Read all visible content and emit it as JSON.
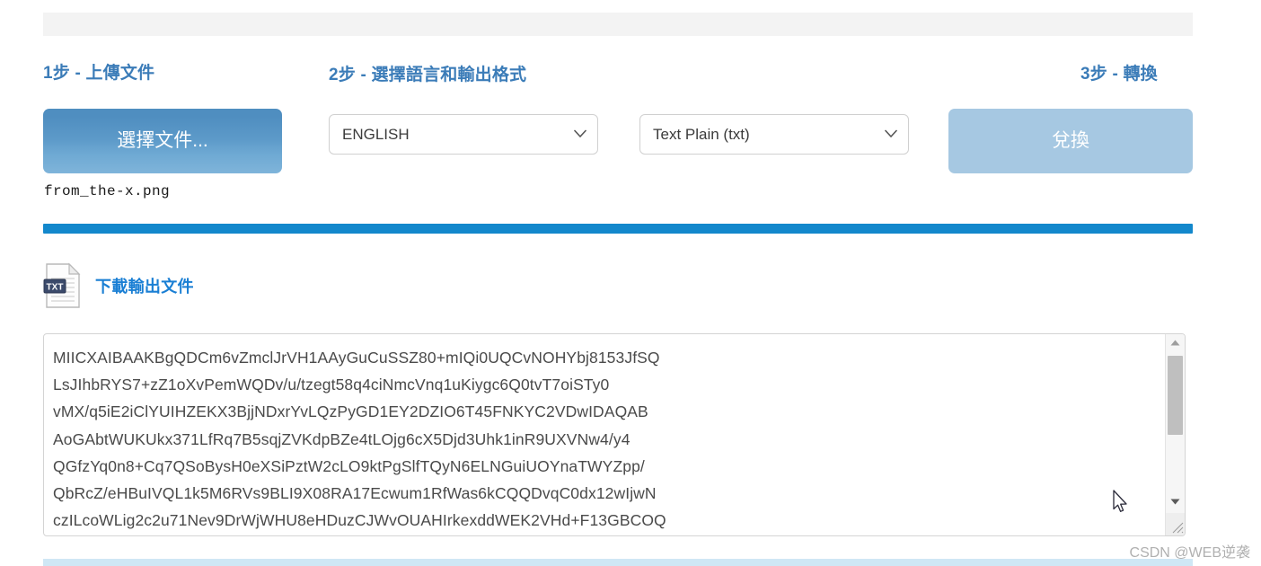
{
  "steps": {
    "step1_heading": "1步 - 上傳文件",
    "step2_heading": "2步 - 選擇語言和輸出格式",
    "step3_heading": "3步 - 轉換"
  },
  "upload": {
    "choose_file_label": "選擇文件...",
    "file_name": "from_the-x.png"
  },
  "options": {
    "language_value": "ENGLISH",
    "format_value": "Text Plain (txt)"
  },
  "convert": {
    "label": "兌換"
  },
  "progress": {
    "percent": 100
  },
  "download": {
    "link_label": "下載輸出文件",
    "icon_badge": "TXT"
  },
  "output": {
    "text": "MIICXAIBAAKBgQDCm6vZmclJrVH1AAyGuCuSSZ80+mIQi0UQCvNOHYbj8153JfSQ\nLsJIhbRYS7+zZ1oXvPemWQDv/u/tzegt58q4ciNmcVnq1uKiygc6Q0tvT7oiSTy0\nvMX/q5iE2iClYUIHZEKX3BjjNDxrYvLQzPyGD1EY2DZIO6T45FNKYC2VDwIDAQAB\nAoGAbtWUKUkx371LfRq7B5sqjZVKdpBZe4tLOjg6cX5Djd3Uhk1inR9UXVNw4/y4\nQGfzYq0n8+Cq7QSoBysH0eXSiPztW2cLO9ktPgSlfTQyN6ELNGuiUOYnaTWYZpp/\nQbRcZ/eHBuIVQL1k5M6RVs9BLI9X08RA17Ecwum1RfWas6kCQQDvqC0dx12wIjwN\nczILcoWLig2c2u71Nev9DrWjWHU8eHDuzCJWvOUAHIrkexddWEK2VHd+F13GBCOQ"
  },
  "watermark": {
    "text": "CSDN @WEB逆袭"
  },
  "colors": {
    "accent_blue": "#3b7cb8",
    "progress_blue": "#1388cc",
    "link_blue": "#1a7fd4",
    "disabled_button": "#a6c8e2"
  }
}
